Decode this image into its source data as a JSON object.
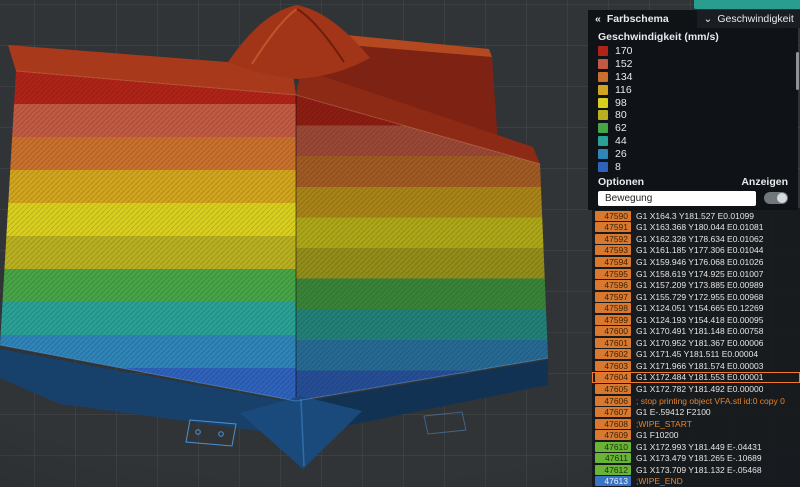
{
  "icons": {
    "collapse": "«",
    "caret": "⌄"
  },
  "legend": {
    "header": {
      "title": "Farbschema",
      "mode": "Geschwindigkeit"
    },
    "title": "Geschwindigkeit (mm/s)",
    "items": [
      {
        "value": "170",
        "color": "#b02418"
      },
      {
        "value": "152",
        "color": "#c05a42"
      },
      {
        "value": "134",
        "color": "#c8702c"
      },
      {
        "value": "116",
        "color": "#d2a51e"
      },
      {
        "value": "98",
        "color": "#d8cf1e"
      },
      {
        "value": "80",
        "color": "#b8b021"
      },
      {
        "value": "62",
        "color": "#47a447"
      },
      {
        "value": "44",
        "color": "#2aa096"
      },
      {
        "value": "26",
        "color": "#2f84b8"
      },
      {
        "value": "8",
        "color": "#2f62bb"
      }
    ],
    "options_label": "Optionen",
    "show_label": "Anzeigen",
    "movement_label": "Bewegung"
  },
  "model": {
    "back_arm_color": "#7e2314",
    "back_arm_top_color": "#b4491f",
    "rim_left_color": "#a8391b",
    "rim_right_color": "#8d2a15",
    "funnel_color": "#a23418",
    "base_left_color": "#17406b",
    "base_right_color": "#123253",
    "base_front_color": "#1a4a7c"
  },
  "gcode": {
    "badge_colors": {
      "orange": {
        "bg": "#d9792f",
        "fg": "#3a2408"
      },
      "green": {
        "bg": "#69b437",
        "fg": "#1d3308"
      },
      "blue": {
        "bg": "#3b74c4",
        "fg": "#eaf2fa"
      }
    },
    "lines": [
      {
        "num": "47590",
        "text": "G1 X164.3 Y181.527 E0.01099"
      },
      {
        "num": "47591",
        "text": "G1 X163.368 Y180.044 E0.01081"
      },
      {
        "num": "47592",
        "text": "G1 X162.328 Y178.634 E0.01062"
      },
      {
        "num": "47593",
        "text": "G1 X161.185 Y177.306 E0.01044"
      },
      {
        "num": "47594",
        "text": "G1 X159.946 Y176.068 E0.01026"
      },
      {
        "num": "47595",
        "text": "G1 X158.619 Y174.925 E0.01007"
      },
      {
        "num": "47596",
        "text": "G1 X157.209 Y173.885 E0.00989"
      },
      {
        "num": "47597",
        "text": "G1 X155.729 Y172.955 E0.00968"
      },
      {
        "num": "47598",
        "text": "G1 X124.051 Y154.665 E0.12269"
      },
      {
        "num": "47599",
        "text": "G1 X124.193 Y154.418 E0.00095"
      },
      {
        "num": "47600",
        "text": "G1 X170.491 Y181.148 E0.00758"
      },
      {
        "num": "47601",
        "text": "G1 X170.952 Y181.367 E0.00006"
      },
      {
        "num": "47602",
        "text": "G1 X171.45 Y181.511 E0.00004"
      },
      {
        "num": "47603",
        "text": "G1 X171.966 Y181.574 E0.00003"
      },
      {
        "num": "47604",
        "text": "G1 X172.484 Y181.553 E0.00001",
        "selected": true
      },
      {
        "num": "47605",
        "text": "G1 X172.782 Y181.492 E0.00000"
      },
      {
        "num": "47606",
        "text": "; stop printing object VFA.stl id:0 copy 0"
      },
      {
        "num": "47607",
        "text": "G1 E-.59412 F2100"
      },
      {
        "num": "47608",
        "text": ";WIPE_START"
      },
      {
        "num": "47609",
        "text": "G1 F10200"
      },
      {
        "num": "47610",
        "text": "G1 X172.993 Y181.449 E-.04431",
        "badge": "green"
      },
      {
        "num": "47611",
        "text": "G1 X173.479 Y181.265 E-.10689",
        "badge": "green"
      },
      {
        "num": "47612",
        "text": "G1 X173.709 Y181.132 E-.05468",
        "badge": "green"
      },
      {
        "num": "47613",
        "text": ";WIPE_END",
        "badge": "blue"
      }
    ]
  }
}
